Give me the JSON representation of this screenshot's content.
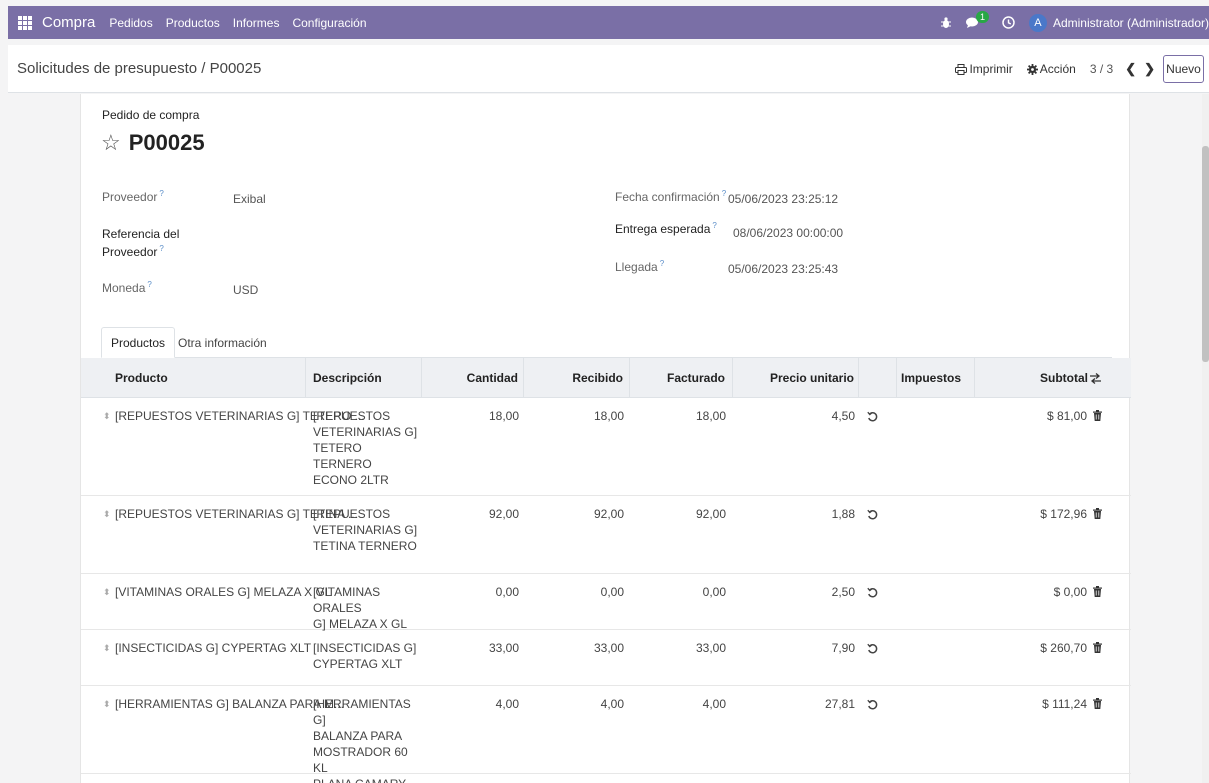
{
  "navbar": {
    "app_name": "Compra",
    "menu": [
      "Pedidos",
      "Productos",
      "Informes",
      "Configuración"
    ],
    "messages_count": "1",
    "avatar_letter": "A",
    "user_name": "Administrator (Administrador)"
  },
  "control_panel": {
    "breadcrumb": "Solicitudes de presupuesto / P00025",
    "print_label": "Imprimir",
    "action_label": "Acción",
    "pager": "3 / 3",
    "new_label": "Nuevo"
  },
  "form": {
    "title_label": "Pedido de compra",
    "order_name": "P00025",
    "fields": {
      "proveedor_label": "Proveedor",
      "proveedor_value": "Exibal",
      "referencia_label_1": "Referencia del",
      "referencia_label_2": "Proveedor",
      "moneda_label": "Moneda",
      "moneda_value": "USD",
      "fecha_conf_label": "Fecha confirmación",
      "fecha_conf_value": "05/06/2023 23:25:12",
      "entrega_label": "Entrega esperada",
      "entrega_value": "08/06/2023 00:00:00",
      "llegada_label": "Llegada",
      "llegada_value": "05/06/2023 23:25:43"
    },
    "tooltip_mark": "?"
  },
  "tabs": {
    "productos": "Productos",
    "otra": "Otra información"
  },
  "table": {
    "headers": {
      "producto": "Producto",
      "descripcion": "Descripción",
      "cantidad": "Cantidad",
      "recibido": "Recibido",
      "facturado": "Facturado",
      "precio": "Precio unitario",
      "impuestos": "Impuestos",
      "subtotal": "Subtotal"
    },
    "rows": [
      {
        "producto": "[REPUESTOS VETERINARIAS G] TETERO ...",
        "desc": [
          "[REPUESTOS",
          "VETERINARIAS G]",
          "TETERO TERNERO",
          "ECONO 2LTR"
        ],
        "cantidad": "18,00",
        "recibido": "18,00",
        "facturado": "18,00",
        "precio": "4,50",
        "subtotal": "$ 81,00"
      },
      {
        "producto": "[REPUESTOS VETERINARIAS G] TETINA ...",
        "desc": [
          "[REPUESTOS",
          "VETERINARIAS G]",
          "TETINA TERNERO"
        ],
        "cantidad": "92,00",
        "recibido": "92,00",
        "facturado": "92,00",
        "precio": "1,88",
        "subtotal": "$ 172,96"
      },
      {
        "producto": "[VITAMINAS ORALES G] MELAZA X GL",
        "desc": [
          "[VITAMINAS ORALES",
          "G] MELAZA X GL"
        ],
        "cantidad": "0,00",
        "recibido": "0,00",
        "facturado": "0,00",
        "precio": "2,50",
        "subtotal": "$ 0,00"
      },
      {
        "producto": "[INSECTICIDAS G] CYPERTAG XLT",
        "desc": [
          "[INSECTICIDAS G]",
          "CYPERTAG XLT"
        ],
        "cantidad": "33,00",
        "recibido": "33,00",
        "facturado": "33,00",
        "precio": "7,90",
        "subtotal": "$ 260,70"
      },
      {
        "producto": "[HERRAMIENTAS G] BALANZA PARA M...",
        "desc": [
          "[HERRAMIENTAS G]",
          "BALANZA PARA",
          "MOSTRADOR 60 KL",
          "PLANA CAMARY"
        ],
        "cantidad": "4,00",
        "recibido": "4,00",
        "facturado": "4,00",
        "precio": "27,81",
        "subtotal": "$ 111,24"
      }
    ]
  },
  "colors": {
    "navbar": "#7a6fa6",
    "accent": "#7a6fa6",
    "badge": "#28a745"
  }
}
